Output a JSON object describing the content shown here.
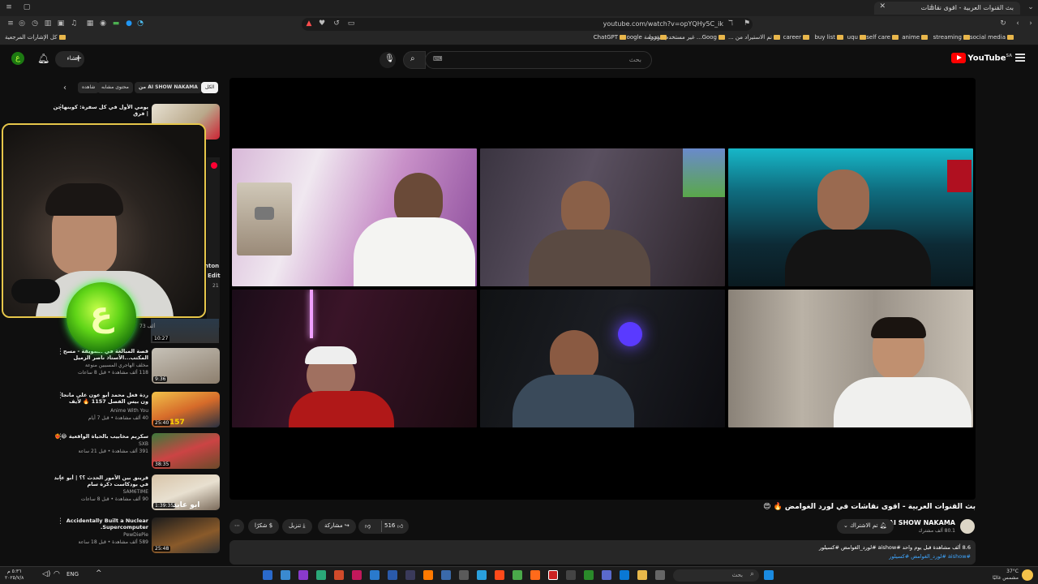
{
  "browser": {
    "tab_title": "بث القنوات العربية - اقوى نقاشات",
    "url": "youtube.com/watch?v=opYQHy5C_ik",
    "bookmarks": [
      "social media",
      "streaming",
      "anime",
      "self care",
      "uqu",
      "buy list",
      "career",
      "تم الاستيراد من ...",
      "Goog... غير مستخدم مؤخرا",
      "ترجمة Google",
      "ChatGPT"
    ],
    "bookmarks_all": "كل الإشارات المرجعية"
  },
  "youtube": {
    "logo_text": "YouTube",
    "logo_region": "SA",
    "search_placeholder": "بحث",
    "create_label": "إنشاء"
  },
  "sidebar": {
    "chips": [
      "الكل",
      "من AI SHOW NAKAMA",
      "محتوى مشابه",
      "شاهده"
    ],
    "partial_texts": {
      "item_left_1": "nton",
      "item_left_2": "Edit",
      "item_left_3": "21"
    },
    "videos": [
      {
        "title": "يومي الأول في كل سفرة: كوبنهاجن | فرق",
        "channel": "",
        "meta": "",
        "duration": ""
      },
      {
        "title": "قصة المبالغة في الطويقة - مسح المكتب...الأستاذ ناصر الزميل",
        "channel": "مخلف الهاجري المسببين منوعة",
        "meta": "118 ألف مشاهدة • قبل 8 ساعات",
        "duration": "9:36"
      },
      {
        "title": "ردة فعل محمد أبو عون على مانجا ون بيس الفصل 1157 🔥 لأيف ريتكشن ...",
        "channel": "Anime With You",
        "meta": "40 ألف مشاهدة • قبل 7 أيام",
        "duration": "25:40"
      },
      {
        "title": "سكربم مخابيب بالحياة الواقعية 😂❤️‍🔥",
        "channel": "SXB",
        "meta": "391 ألف مشاهدة • قبل 21 ساعة",
        "duration": "38:35"
      },
      {
        "title": "قرينق بين الأمور الحدث ؟؟ | أبو عابد في بودكاست ذكرة سام",
        "channel": "SAM6TIME",
        "meta": "90 ألف مشاهدة • قبل 8 ساعات",
        "duration": "1:39:35"
      },
      {
        "title": "Accidentally Built a Nuclear Supercomputer.",
        "channel": "PewDiePie",
        "meta": "589 ألف مشاهدة • قبل 18 ساعة",
        "duration": "25:48"
      }
    ],
    "durations_extra": [
      "10:27"
    ],
    "small_labels": [
      "73 ألف"
    ]
  },
  "video": {
    "title": "بث القنوات العربية - اقوى نقاشات في لورد الغوامض 🔥 😍",
    "channel": "AI SHOW NAKAMA",
    "subscribers": "80.1 ألف مشترك",
    "subscribe_label": "تم الاشتراك",
    "likes": "516",
    "share_label": "مشاركة",
    "download_label": "تنزيل",
    "thanks_label": "شكرًا",
    "views_line": "8.6 ألف مشاهدة  قبل يوم واحد  #aishow #لورد_الغوامض #كسيلور",
    "hashtags": "#aishow #لورد_الغوامض #كسيلور",
    "overlay_word": "ابو عابد",
    "small_number": "157"
  },
  "taskbar": {
    "search_placeholder": "بحث",
    "lang": "ENG",
    "time": "٥:٣٦ م",
    "date": "٢٠٢٥/٧/٨",
    "weather": "37°C",
    "weather_desc": "مشمس غالبًا"
  },
  "colors": {
    "yt_red": "#ff0000",
    "webcam_border": "#e6c64a",
    "logo_green": "#5fd417"
  }
}
